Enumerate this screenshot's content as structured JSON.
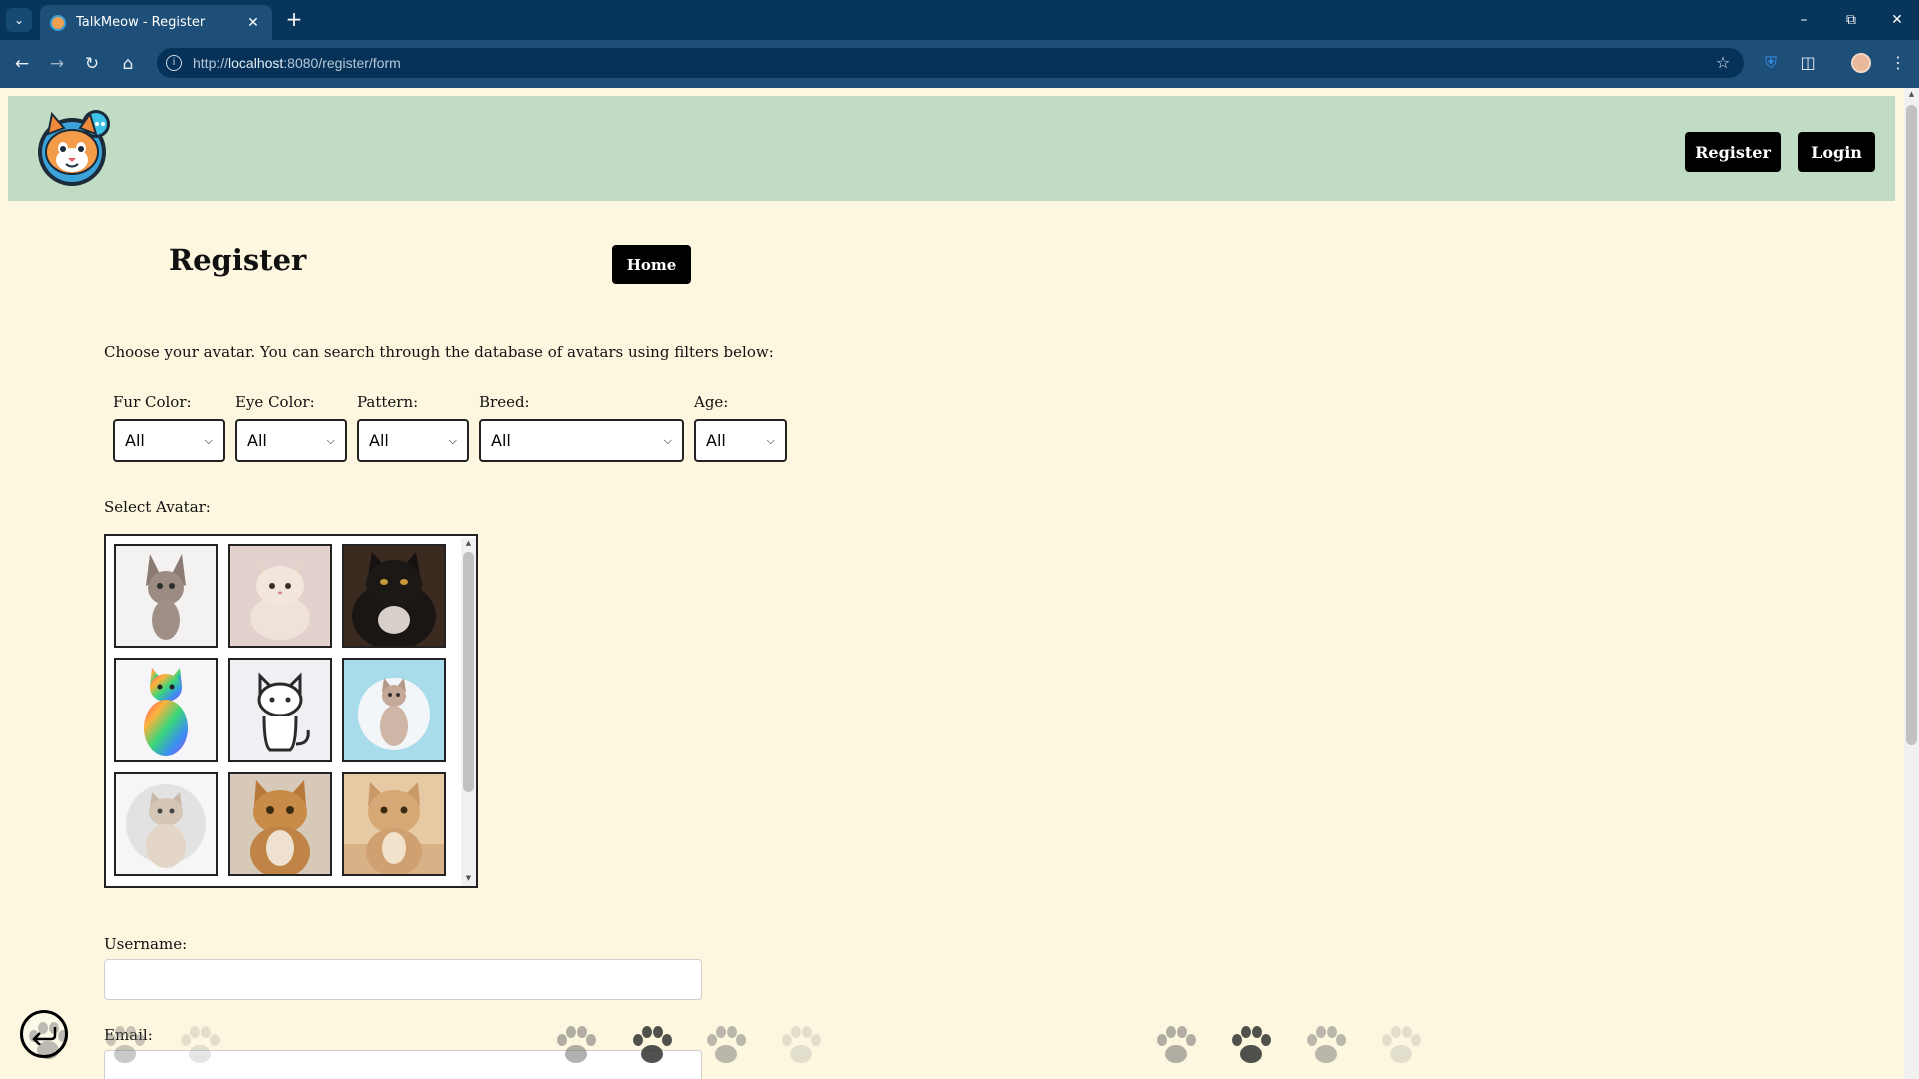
{
  "browser": {
    "tab_title": "TalkMeow - Register",
    "url_prefix": "http://",
    "url_host": "localhost",
    "url_path": ":8080/register/form"
  },
  "header": {
    "register_label": "Register",
    "login_label": "Login"
  },
  "page": {
    "title": "Register",
    "home_label": "Home",
    "intro": "Choose your avatar. You can search through the database of avatars using filters below:"
  },
  "filters": [
    {
      "label": "Fur Color:",
      "value": "All"
    },
    {
      "label": "Eye Color:",
      "value": "All"
    },
    {
      "label": "Pattern:",
      "value": "All"
    },
    {
      "label": "Breed:",
      "value": "All"
    },
    {
      "label": "Age:",
      "value": "All"
    }
  ],
  "avatar_section": {
    "label": "Select Avatar:",
    "avatars": [
      "sphynx-cat-icon",
      "white-fluffy-cat-icon",
      "black-longhair-cat-icon",
      "rainbow-cat-icon",
      "line-drawing-cat-icon",
      "pastel-tabby-cat-icon",
      "grey-british-cat-icon",
      "orange-tabby-cat-icon",
      "sand-cat-icon"
    ]
  },
  "form": {
    "username_label": "Username:",
    "username_value": "",
    "email_label": "Email:",
    "email_value": ""
  },
  "colors": {
    "browser_frame": "#07355b",
    "browser_toolbar": "#1d4f78",
    "header_bg": "#c0dcc4",
    "page_bg": "#fdf7df",
    "button_bg": "#000000"
  }
}
